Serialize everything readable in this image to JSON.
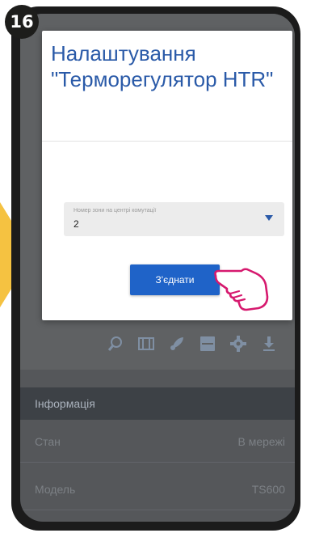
{
  "step": {
    "number": "16"
  },
  "dialog": {
    "title": "Налаштування \"Терморегулятор HTR\"",
    "select_label": "Номер зони на центрі комутації",
    "select_value": "2",
    "connect_label": "З'єднати"
  },
  "background": {
    "toolbar_icons": [
      "search-icon",
      "film-icon",
      "rocket-icon",
      "save-icon",
      "gear-icon",
      "download-icon"
    ],
    "info_header": "Інформація",
    "rows": [
      {
        "label": "Стан",
        "value": "В мережі"
      },
      {
        "label": "Модель",
        "value": "TS600"
      }
    ]
  },
  "colors": {
    "accent": "#1f63c8",
    "title": "#2a5aa8",
    "highlight_arrow": "#f5c241",
    "hand_outline": "#d6196e"
  }
}
